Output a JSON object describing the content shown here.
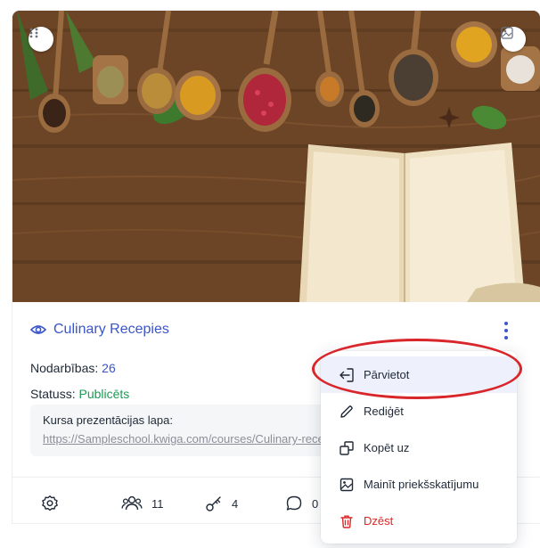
{
  "course": {
    "title": "Culinary Recepies",
    "lessons_label": "Nodarbības:",
    "lessons_value": "26",
    "status_label": "Statuss:",
    "status_value": "Publicēts",
    "presentation_label": "Kursa prezentācijas lapa:",
    "presentation_url": "https://Sampleschool.kwiga.com/courses/Culinary-recepies"
  },
  "stats": {
    "students": "11",
    "keys": "4",
    "comments": "0"
  },
  "menu": {
    "items": [
      {
        "label": "Pārvietot",
        "icon": "move-icon"
      },
      {
        "label": "Rediģēt",
        "icon": "pencil-icon"
      },
      {
        "label": "Kopēt uz",
        "icon": "copy-icon"
      },
      {
        "label": "Mainīt priekšskatījumu",
        "icon": "image-icon"
      },
      {
        "label": "Dzēst",
        "icon": "trash-icon"
      }
    ]
  },
  "colors": {
    "accent": "#3a55c8",
    "success": "#1e9b55",
    "danger": "#dc2626",
    "highlight": "#d9262b"
  }
}
